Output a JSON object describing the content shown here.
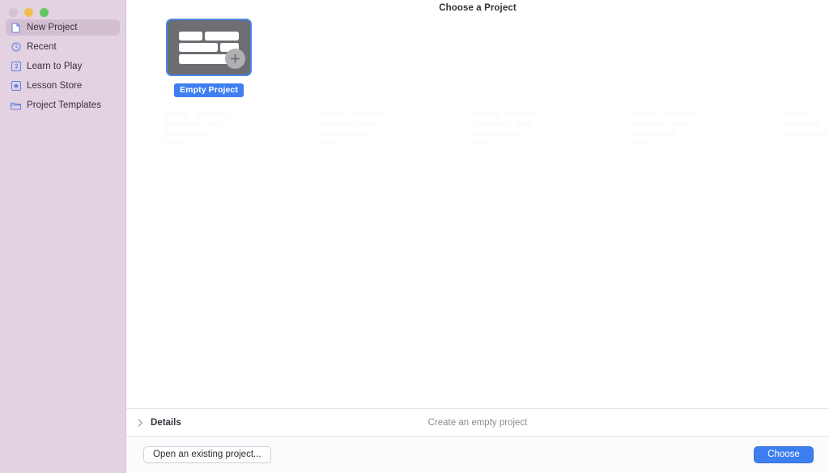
{
  "window": {
    "title": "Choose a Project",
    "traffic_lights": [
      {
        "name": "close",
        "color": "#d3c4d2"
      },
      {
        "name": "minimize",
        "color": "#f2bf4f"
      },
      {
        "name": "maximize",
        "color": "#5fc75d"
      }
    ]
  },
  "sidebar": {
    "background": "#e3d2e2",
    "selected_index": 0,
    "items": [
      {
        "label": "New Project",
        "icon": "document-icon"
      },
      {
        "label": "Recent",
        "icon": "clock-icon"
      },
      {
        "label": "Learn to Play",
        "icon": "music-note-icon"
      },
      {
        "label": "Lesson Store",
        "icon": "star-icon"
      },
      {
        "label": "Project Templates",
        "icon": "folder-icon"
      }
    ]
  },
  "main": {
    "projects": [
      {
        "name": "Empty Project",
        "selected": true,
        "thumbnail_icon": "tracks-with-plus-icon",
        "accent": "#3d7ff0"
      }
    ]
  },
  "details": {
    "label": "Details",
    "disclosure_icon": "chevron-right-icon",
    "expanded": false,
    "description": "Create an empty project"
  },
  "footer": {
    "open_existing_label": "Open an existing project...",
    "choose_label": "Choose",
    "choose_accent": "#3d7ff0"
  }
}
